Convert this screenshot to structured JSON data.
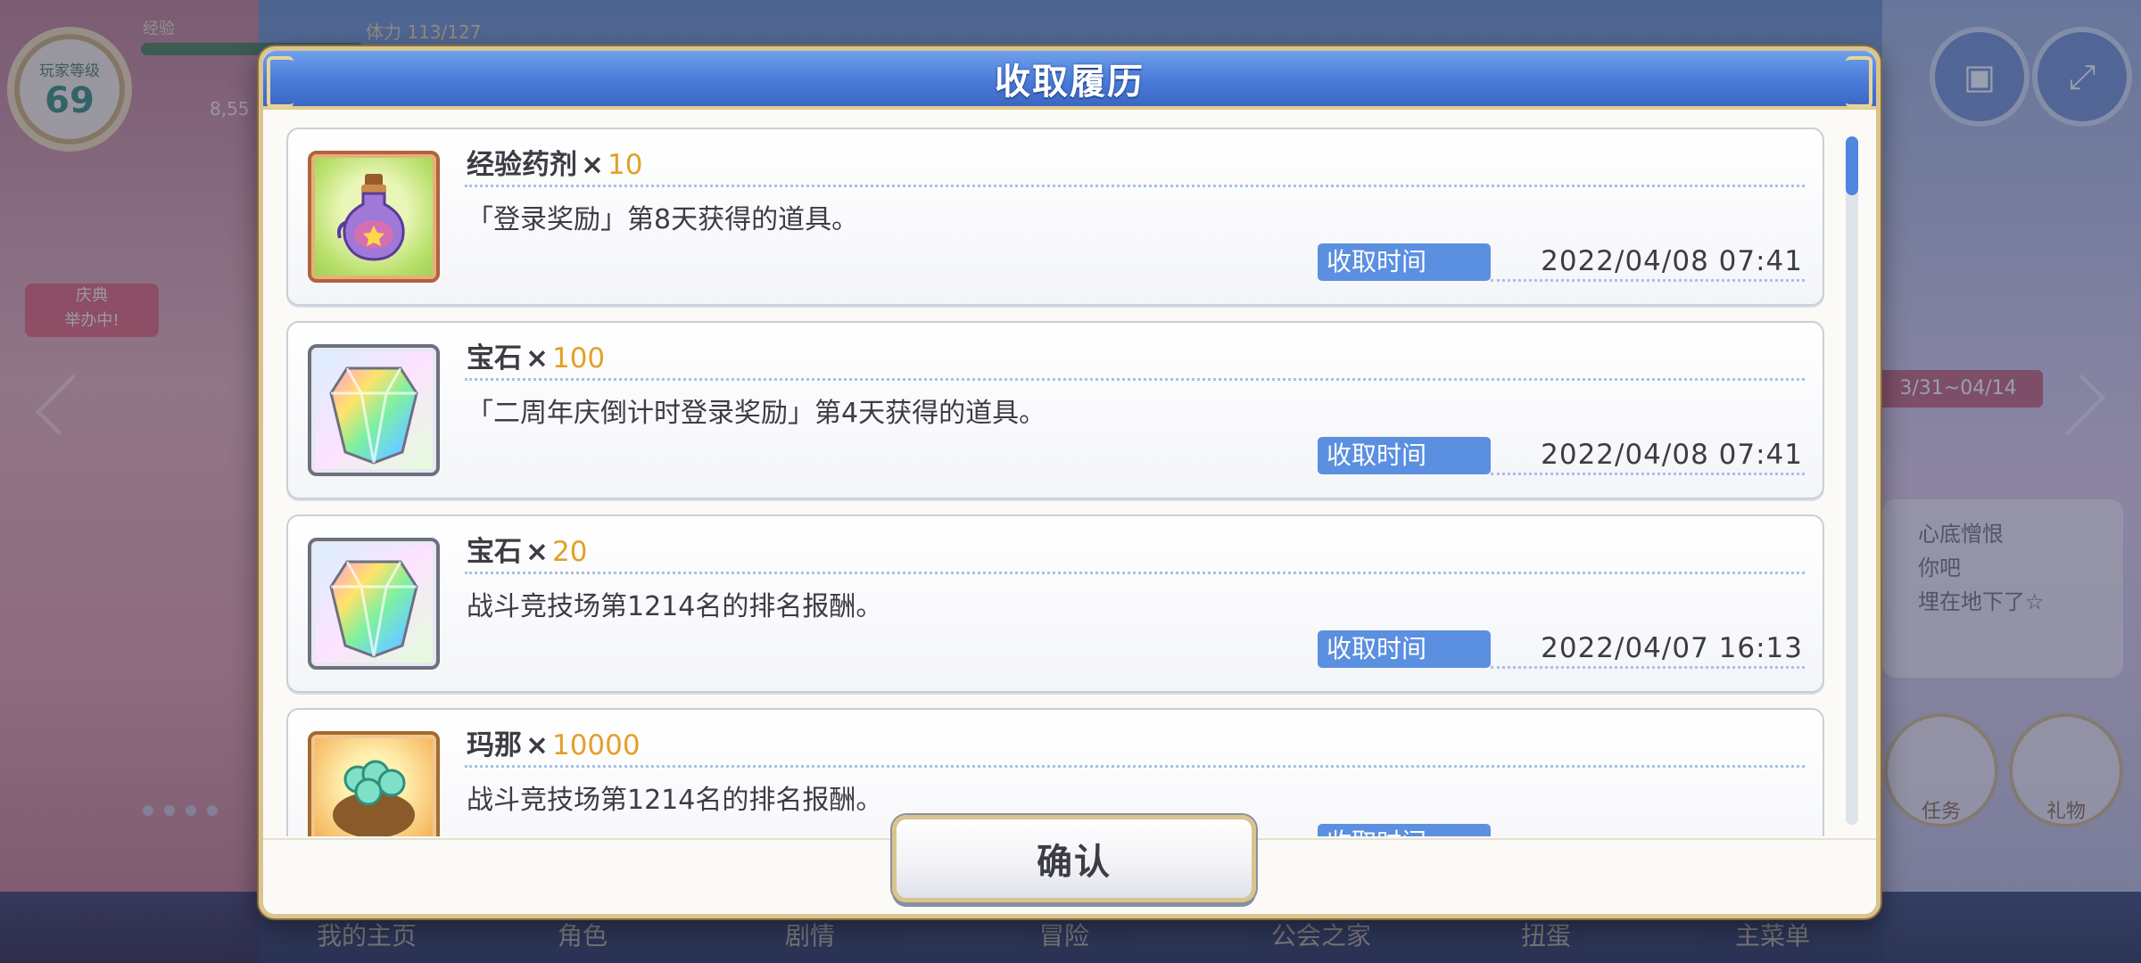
{
  "background": {
    "player_level_label": "玩家等级",
    "player_level": "69",
    "exp_label": "经验",
    "stamina_text": "体力 113/127",
    "gold_value": "8,55",
    "event_badge": "庆典\n举办中!",
    "banner_date": "3/31~04/14",
    "news_lines": [
      "心底憎恨",
      "你吧",
      "埋在地下了☆"
    ],
    "task_label": "任务",
    "gift_label": "礼物",
    "bottom_nav": [
      "我的主页",
      "角色",
      "剧情",
      "冒险",
      "公会之家",
      "扭蛋",
      "主菜单"
    ]
  },
  "dialog": {
    "title": "收取履历",
    "records": [
      {
        "icon": "potion-icon",
        "name": "经验药剂",
        "times": "×",
        "quantity": "10",
        "description": "「登录奖励」第8天获得的道具。",
        "time_label": "收取时间",
        "time": "2022/04/08  07:41"
      },
      {
        "icon": "gem-icon",
        "name": "宝石",
        "times": "×",
        "quantity": "100",
        "description": "「二周年庆倒计时登录奖励」第4天获得的道具。",
        "time_label": "收取时间",
        "time": "2022/04/08  07:41"
      },
      {
        "icon": "gem-icon",
        "name": "宝石",
        "times": "×",
        "quantity": "20",
        "description": "战斗竞技场第1214名的排名报酬。",
        "time_label": "收取时间",
        "time": "2022/04/07  16:13"
      },
      {
        "icon": "mana-icon",
        "name": "玛那",
        "times": "×",
        "quantity": "10000",
        "description": "战斗竞技场第1214名的排名报酬。",
        "time_label": "收取时间",
        "time": ""
      }
    ],
    "confirm_label": "确认"
  },
  "colors": {
    "header_blue": "#4a7bd8",
    "quantity_gold": "#e2a02a",
    "time_label_bg": "#5b8fe0",
    "frame_gold": "#d9c48e"
  }
}
